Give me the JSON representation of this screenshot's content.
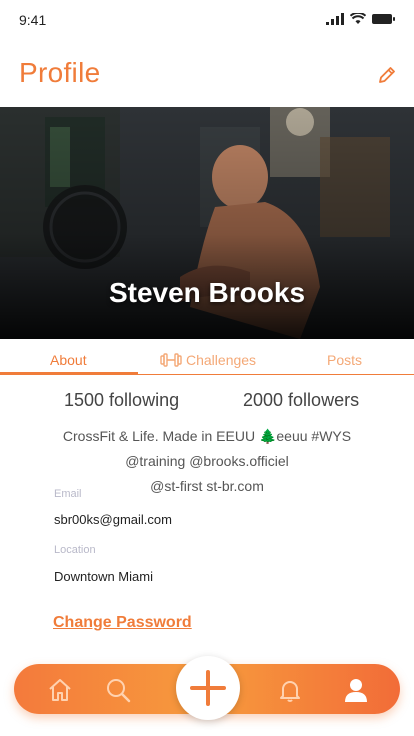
{
  "status": {
    "time": "9:41"
  },
  "header": {
    "title": "Profile"
  },
  "profile": {
    "name": "Steven Brooks"
  },
  "tabs": [
    {
      "label": "About",
      "active": true
    },
    {
      "label": "Challenges",
      "icon": "dumbbell-icon"
    },
    {
      "label": "Posts"
    }
  ],
  "stats": {
    "following": "1500 following",
    "followers": "2000 followers"
  },
  "bio": {
    "line1": "CrossFit & Life. Made in EEUU 🌲eeuu #WYS",
    "line2": "@training @brooks.officiel",
    "line3": "@st-first   st-br.com"
  },
  "fields": {
    "email_label": "Email",
    "email_value": "sbr00ks@gmail.com",
    "location_label": "Location",
    "location_value": "Downtown Miami"
  },
  "links": {
    "change_password": "Change Password"
  },
  "colors": {
    "accent": "#f07c3a"
  },
  "tabbar_icons": [
    "home-icon",
    "search-icon",
    "add-icon",
    "bell-icon",
    "profile-icon"
  ]
}
